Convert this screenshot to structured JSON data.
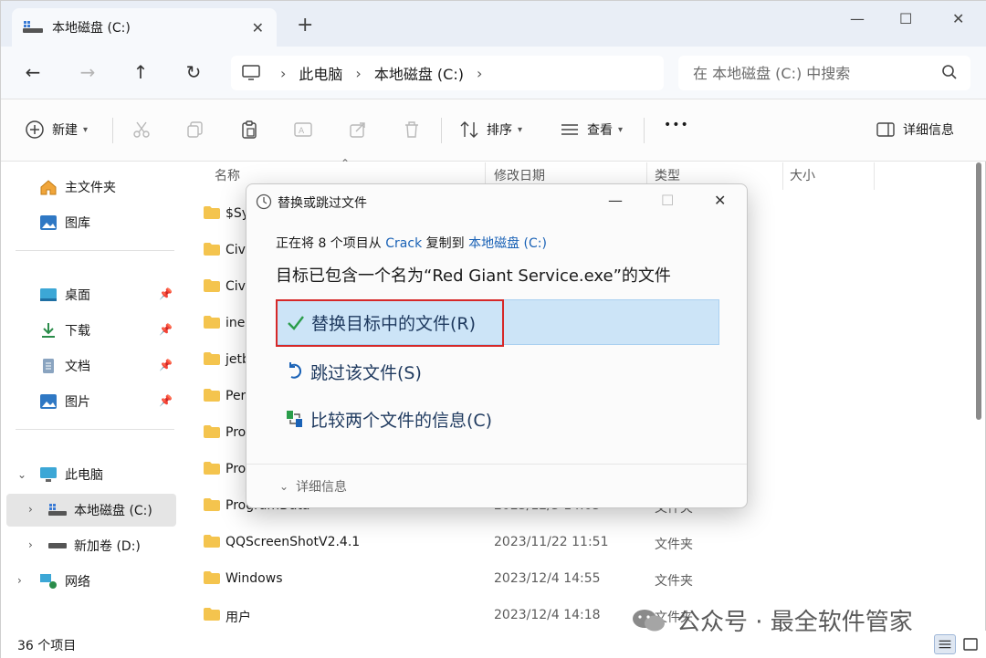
{
  "tab": {
    "title": "本地磁盘 (C:)",
    "close": "✕",
    "new_tab": "+"
  },
  "window_controls": {
    "minimize": "—",
    "maximize": "☐",
    "close": "✕"
  },
  "nav": {
    "back": "←",
    "forward": "→",
    "up": "↑",
    "refresh": "↻"
  },
  "breadcrumb": {
    "sep": "›",
    "items": [
      "此电脑",
      "本地磁盘 (C:)"
    ]
  },
  "search": {
    "placeholder": "在 本地磁盘 (C:) 中搜索"
  },
  "toolbar": {
    "new_label": "新建",
    "sort_label": "排序",
    "view_label": "查看",
    "more": "•••",
    "details_label": "详细信息"
  },
  "sidebar": {
    "home": "主文件夹",
    "gallery": "图库",
    "desktop": "桌面",
    "downloads": "下载",
    "documents": "文档",
    "pictures": "图片",
    "this_pc": "此电脑",
    "local_disk": "本地磁盘 (C:)",
    "new_volume": "新加卷 (D:)",
    "network": "网络"
  },
  "columns": {
    "name": "名称",
    "date": "修改日期",
    "type": "类型",
    "size": "大小"
  },
  "rows": [
    {
      "name": "$Sy",
      "date": "",
      "type": ""
    },
    {
      "name": "Civ",
      "date": "",
      "type": ""
    },
    {
      "name": "Civ",
      "date": "",
      "type": ""
    },
    {
      "name": "ine",
      "date": "",
      "type": ""
    },
    {
      "name": "jetb",
      "date": "",
      "type": ""
    },
    {
      "name": "Per",
      "date": "",
      "type": ""
    },
    {
      "name": "Pro",
      "date": "",
      "type": ""
    },
    {
      "name": "Pro",
      "date": "",
      "type": ""
    },
    {
      "name": "ProgramData",
      "date": "2023/12/5 14:05",
      "type": "文件夹"
    },
    {
      "name": "QQScreenShotV2.4.1",
      "date": "2023/11/22 11:51",
      "type": "文件夹"
    },
    {
      "name": "Windows",
      "date": "2023/12/4 14:55",
      "type": "文件夹"
    },
    {
      "name": "用户",
      "date": "2023/12/4 14:18",
      "type": "文件夹"
    }
  ],
  "status": {
    "count": "36 个项目"
  },
  "watermark": {
    "text": "公众号 · 最全软件管家"
  },
  "dialog": {
    "title": "替换或跳过文件",
    "info_prefix": "正在将 8 个项目从 ",
    "source": "Crack",
    "info_mid": " 复制到 ",
    "dest": "本地磁盘 (C:)",
    "heading": "目标已包含一个名为“Red Giant Service.exe”的文件",
    "replace": "替换目标中的文件(R)",
    "skip": "跳过该文件(S)",
    "compare": "比较两个文件的信息(C)",
    "more": "详细信息"
  },
  "colors": {
    "accent": "#1a62b6",
    "highlight": "#cce4f7",
    "annotation_red": "#d62828",
    "folder": "#f4c44e"
  }
}
